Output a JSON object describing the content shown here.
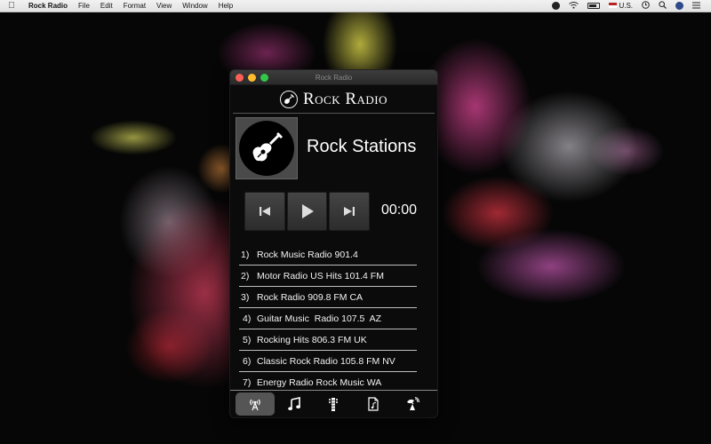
{
  "menubar": {
    "app_name": "Rock Radio",
    "menus": [
      "File",
      "Edit",
      "Format",
      "View",
      "Window",
      "Help"
    ],
    "input_source": "U.S."
  },
  "window": {
    "title": "Rock Radio",
    "brand": "Rock Radio",
    "station_title": "Rock Stations",
    "elapsed_time": "00:00"
  },
  "stations": [
    {
      "num": "1)",
      "name": "Rock Music Radio 901.4"
    },
    {
      "num": "2)",
      "name": "Motor Radio US Hits 101.4 FM"
    },
    {
      "num": "3)",
      "name": "Rock Radio 909.8 FM CA"
    },
    {
      "num": "4)",
      "name": "Guitar Music  Radio 107.5  AZ"
    },
    {
      "num": "5)",
      "name": "Rocking Hits 806.3 FM UK"
    },
    {
      "num": "6)",
      "name": "Classic Rock Radio 105.8 FM NV"
    },
    {
      "num": "7)",
      "name": "Energy Radio Rock Music WA"
    }
  ],
  "tabs": [
    {
      "icon": "radio-antenna-icon",
      "active": true
    },
    {
      "icon": "music-note-icon",
      "active": false
    },
    {
      "icon": "guitar-neck-icon",
      "active": false
    },
    {
      "icon": "document-icon",
      "active": false
    },
    {
      "icon": "satellite-dish-icon",
      "active": false
    }
  ],
  "colors": {
    "window_bg": "#0b0b0b",
    "active_tab": "#555555",
    "close": "#fc5f57",
    "minimize": "#fdbc2e",
    "maximize": "#33c748"
  }
}
